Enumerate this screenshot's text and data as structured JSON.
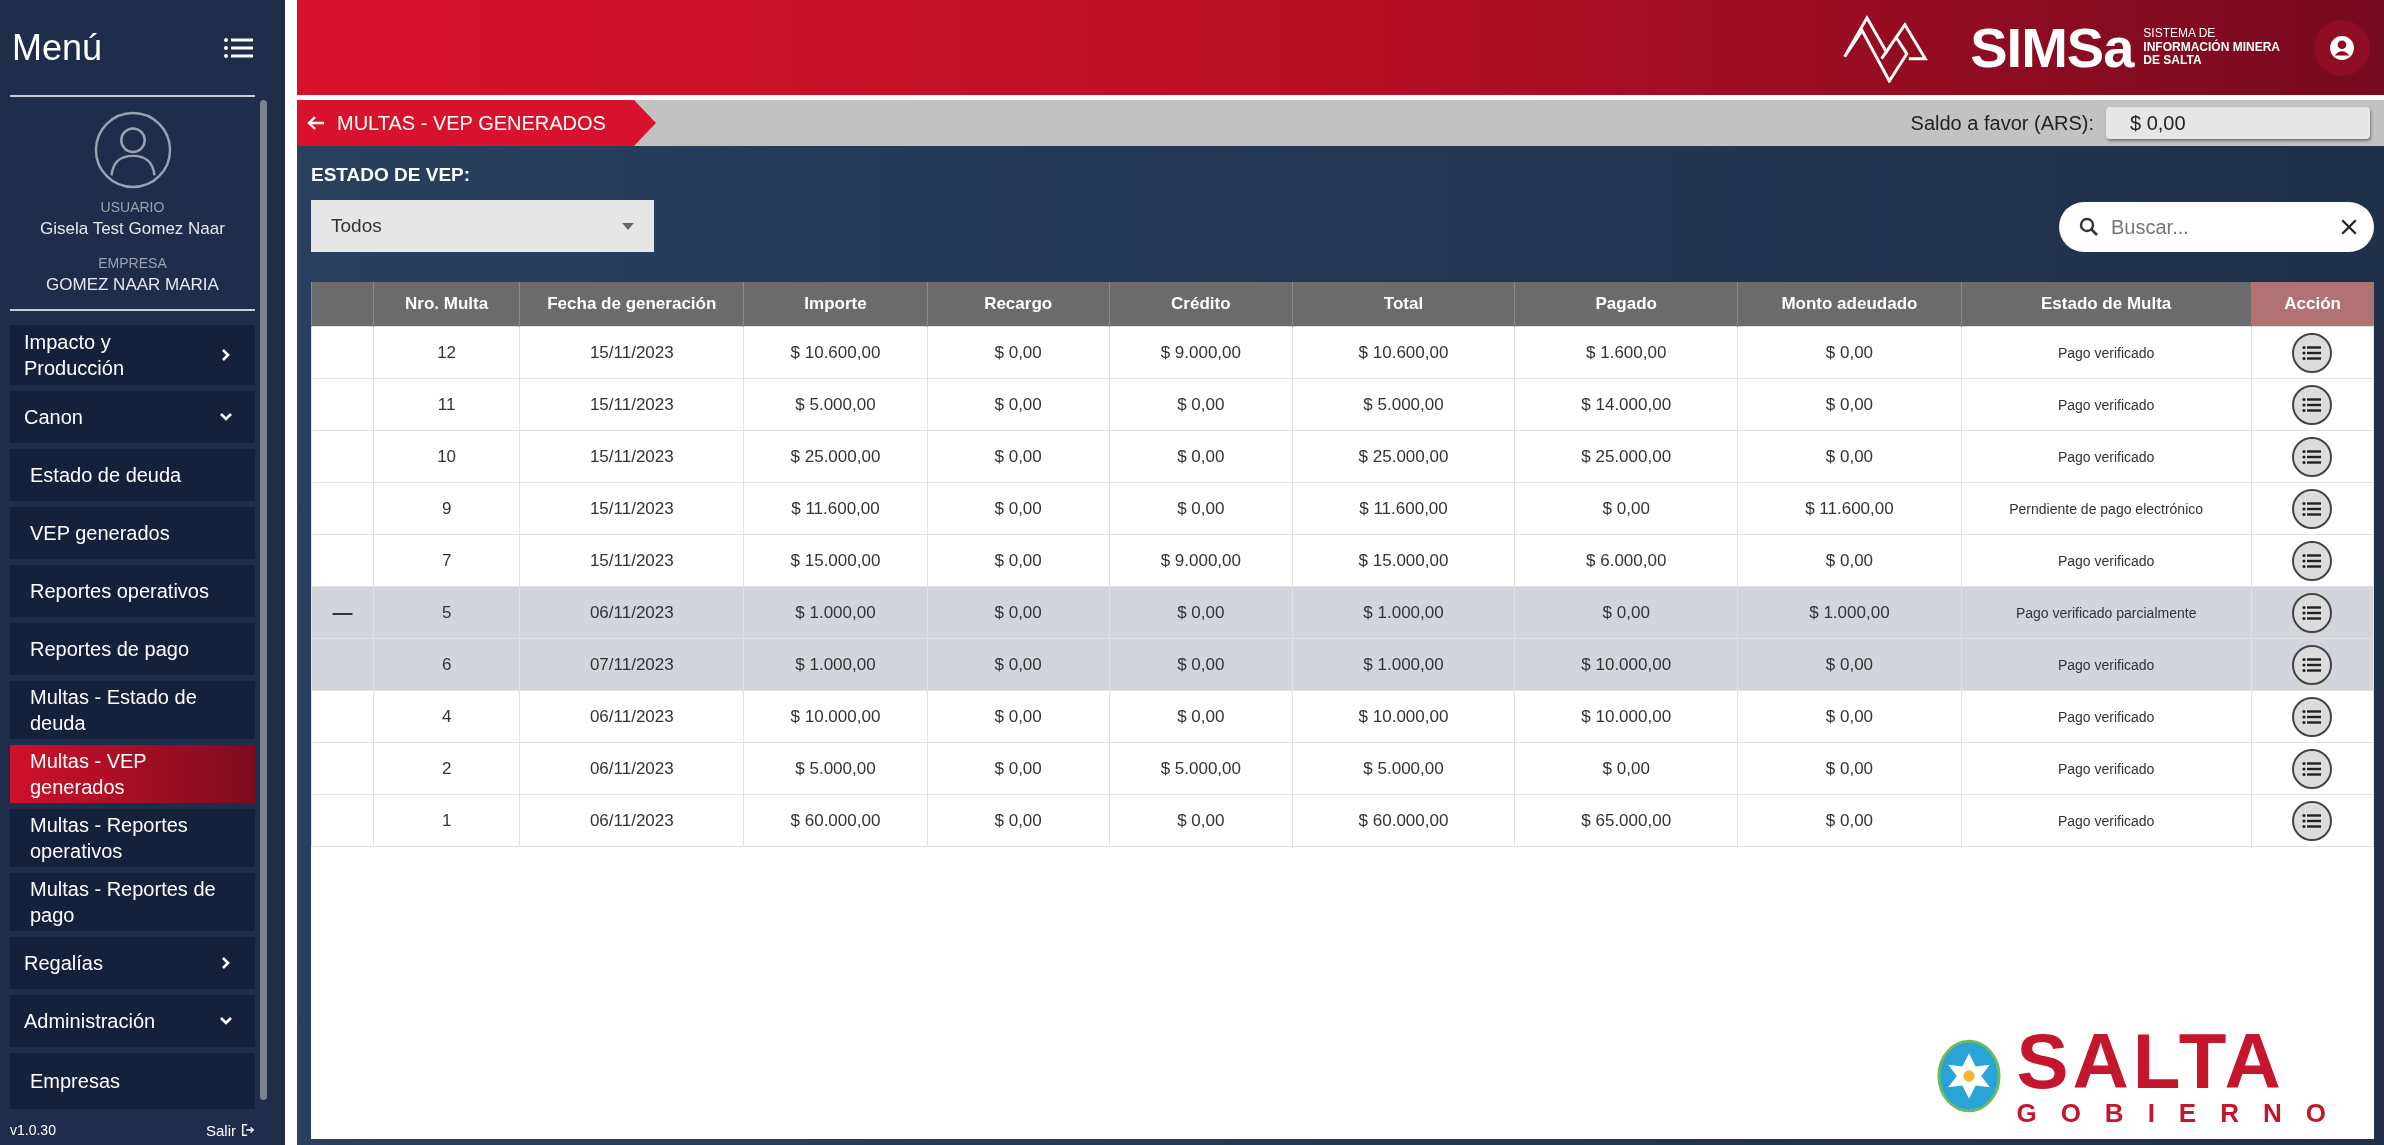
{
  "sidebar": {
    "title": "Menú",
    "user_label": "USUARIO",
    "user_name": "Gisela Test Gomez Naar",
    "company_label": "EMPRESA",
    "company_name": "GOMEZ NAAR MARIA",
    "items": [
      {
        "kind": "section",
        "label": "Impacto y Producción",
        "expanded": false,
        "selected": false
      },
      {
        "kind": "section",
        "label": "Canon",
        "expanded": true,
        "selected": false
      },
      {
        "kind": "sub",
        "label": "Estado de deuda",
        "selected": false
      },
      {
        "kind": "sub",
        "label": "VEP generados",
        "selected": false
      },
      {
        "kind": "sub",
        "label": "Reportes operativos",
        "selected": false
      },
      {
        "kind": "sub",
        "label": "Reportes de pago",
        "selected": false
      },
      {
        "kind": "sub",
        "label": "Multas - Estado de deuda",
        "selected": false
      },
      {
        "kind": "sub",
        "label": "Multas - VEP generados",
        "selected": true
      },
      {
        "kind": "sub",
        "label": "Multas - Reportes operativos",
        "selected": false
      },
      {
        "kind": "sub",
        "label": "Multas - Reportes de pago",
        "selected": false
      },
      {
        "kind": "section",
        "label": "Regalías",
        "expanded": false,
        "selected": false
      },
      {
        "kind": "section",
        "label": "Administración",
        "expanded": true,
        "selected": false
      },
      {
        "kind": "sub",
        "label": "Empresas",
        "selected": false
      }
    ],
    "version": "v1.0.30",
    "logout": "Salir"
  },
  "header": {
    "logo": "SIMSa",
    "tagline": [
      "SISTEMA DE",
      "INFORMACIÓN MINERA",
      "DE SALTA"
    ]
  },
  "breadcrumb": {
    "title": "MULTAS - VEP GENERADOS",
    "balance_label": "Saldo a favor (ARS):",
    "balance_value": "$ 0,00"
  },
  "filter": {
    "label": "ESTADO DE VEP:",
    "value": "Todos"
  },
  "search": {
    "placeholder": "Buscar..."
  },
  "table": {
    "columns": [
      "",
      "Nro. Multa",
      "Fecha de generación",
      "Importe",
      "Recargo",
      "Crédito",
      "Total",
      "Pagado",
      "Monto adeudado",
      "Estado de Multa",
      "Acción"
    ],
    "rows": [
      {
        "highlighted": false,
        "cells": [
          "",
          "12",
          "15/11/2023",
          "$ 10.600,00",
          "$ 0,00",
          "$ 9.000,00",
          "$ 10.600,00",
          "$ 1.600,00",
          "$ 0,00",
          "Pago verificado"
        ]
      },
      {
        "highlighted": false,
        "cells": [
          "",
          "11",
          "15/11/2023",
          "$ 5.000,00",
          "$ 0,00",
          "$ 0,00",
          "$ 5.000,00",
          "$ 14.000,00",
          "$ 0,00",
          "Pago verificado"
        ]
      },
      {
        "highlighted": false,
        "cells": [
          "",
          "10",
          "15/11/2023",
          "$ 25.000,00",
          "$ 0,00",
          "$ 0,00",
          "$ 25.000,00",
          "$ 25.000,00",
          "$ 0,00",
          "Pago verificado"
        ]
      },
      {
        "highlighted": false,
        "cells": [
          "",
          "9",
          "15/11/2023",
          "$ 11.600,00",
          "$ 0,00",
          "$ 0,00",
          "$ 11.600,00",
          "$ 0,00",
          "$ 11.600,00",
          "Perndiente de pago electrónico"
        ]
      },
      {
        "highlighted": false,
        "cells": [
          "",
          "7",
          "15/11/2023",
          "$ 15.000,00",
          "$ 0,00",
          "$ 9.000,00",
          "$ 15.000,00",
          "$ 6.000,00",
          "$ 0,00",
          "Pago verificado"
        ]
      },
      {
        "highlighted": true,
        "cells": [
          "—",
          "5",
          "06/11/2023",
          "$ 1.000,00",
          "$ 0,00",
          "$ 0,00",
          "$ 1.000,00",
          "$ 0,00",
          "$ 1.000,00",
          "Pago verificado parcialmente"
        ]
      },
      {
        "highlighted": true,
        "cells": [
          "",
          "6",
          "07/11/2023",
          "$ 1.000,00",
          "$ 0,00",
          "$ 0,00",
          "$ 1.000,00",
          "$ 10.000,00",
          "$ 0,00",
          "Pago verificado"
        ]
      },
      {
        "highlighted": false,
        "cells": [
          "",
          "4",
          "06/11/2023",
          "$ 10.000,00",
          "$ 0,00",
          "$ 0,00",
          "$ 10.000,00",
          "$ 10.000,00",
          "$ 0,00",
          "Pago verificado"
        ]
      },
      {
        "highlighted": false,
        "cells": [
          "",
          "2",
          "06/11/2023",
          "$ 5.000,00",
          "$ 0,00",
          "$ 5.000,00",
          "$ 5.000,00",
          "$ 0,00",
          "$ 0,00",
          "Pago verificado"
        ]
      },
      {
        "highlighted": false,
        "cells": [
          "",
          "1",
          "06/11/2023",
          "$ 60.000,00",
          "$ 0,00",
          "$ 0,00",
          "$ 60.000,00",
          "$ 65.000,00",
          "$ 0,00",
          "Pago verificado"
        ]
      }
    ]
  },
  "footer_logo": {
    "name": "SALTA",
    "subtitle": "GOBIERNO"
  }
}
